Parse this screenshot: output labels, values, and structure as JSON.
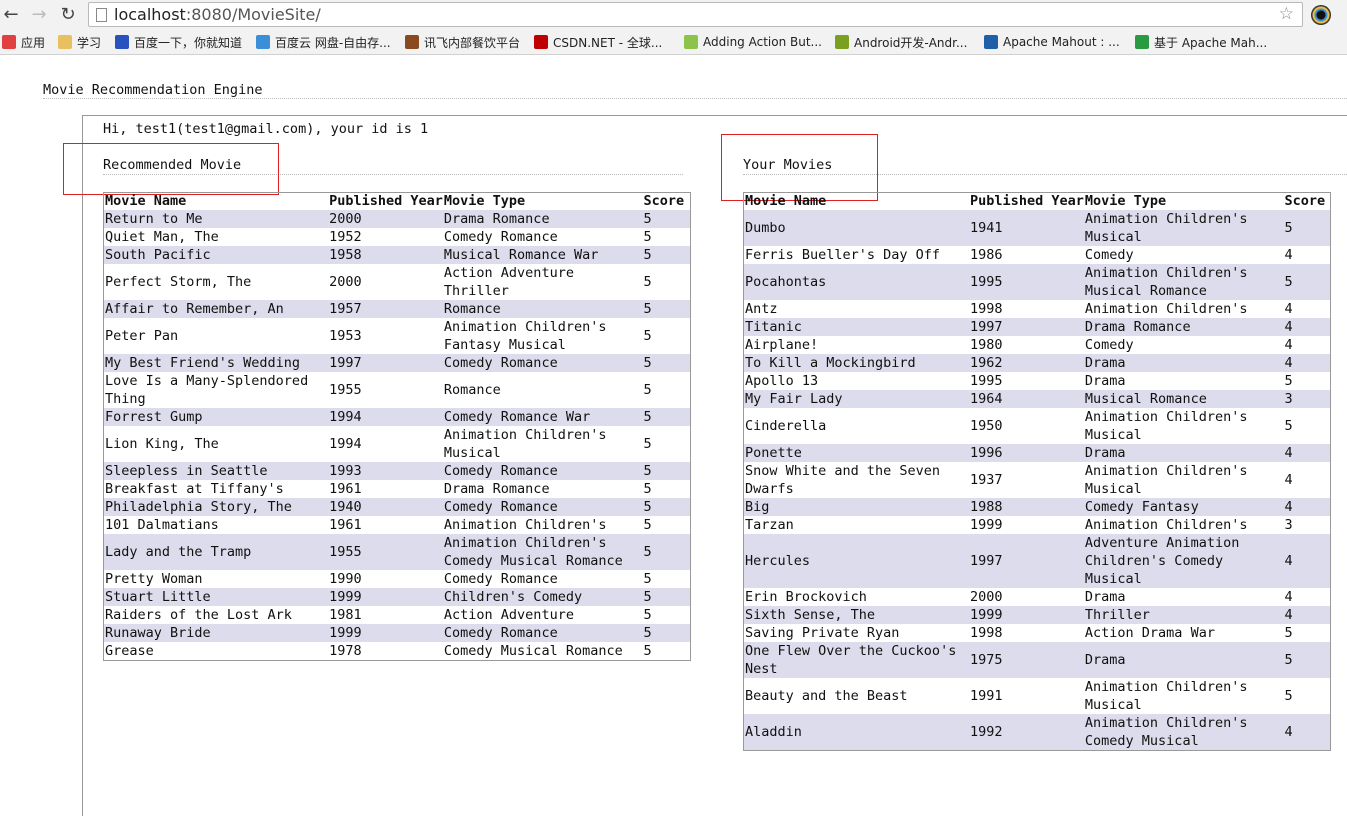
{
  "browser": {
    "url_host": "localhost",
    "url_rest": ":8080/MovieSite/",
    "bookmarks": [
      {
        "label": "应用",
        "icon": "apps-grid-icon",
        "color": "#e04040"
      },
      {
        "label": "学习",
        "icon": "folder-icon",
        "color": "#e8c060"
      },
      {
        "label": "百度一下，你就知道",
        "icon": "baidu-paw-icon",
        "color": "#2a52be"
      },
      {
        "label": "百度云 网盘-自由存...",
        "icon": "baidu-cloud-icon",
        "color": "#3a8fd8"
      },
      {
        "label": "讯飞内部餐饮平台",
        "icon": "bowl-icon",
        "color": "#8a4a20"
      },
      {
        "label": "CSDN.NET - 全球...",
        "icon": "csdn-icon",
        "color": "#c00000"
      },
      {
        "label": "Adding Action But...",
        "icon": "android-icon",
        "color": "#8cc34a"
      },
      {
        "label": "Android开发-Andr...",
        "icon": "android-dev-icon",
        "color": "#7aa020"
      },
      {
        "label": "Apache Mahout : ...",
        "icon": "ibm-icon",
        "color": "#1f5fa8"
      },
      {
        "label": "基于 Apache Mah...",
        "icon": "c-logo-icon",
        "color": "#2a9a40"
      }
    ]
  },
  "page": {
    "title": "Movie Recommendation Engine",
    "greeting": "Hi, test1(test1@gmail.com), your id is 1",
    "recommended": {
      "title": "Recommended Movie",
      "columns": [
        "Movie Name",
        "Published Year",
        "Movie Type",
        "Score"
      ],
      "rows": [
        [
          "Return to Me",
          "2000",
          "Drama Romance",
          "5"
        ],
        [
          "Quiet Man, The",
          "1952",
          "Comedy Romance",
          "5"
        ],
        [
          "South Pacific",
          "1958",
          "Musical Romance War",
          "5"
        ],
        [
          "Perfect Storm, The",
          "2000",
          "Action Adventure Thriller",
          "5"
        ],
        [
          "Affair to Remember, An",
          "1957",
          "Romance",
          "5"
        ],
        [
          "Peter Pan",
          "1953",
          "Animation Children's Fantasy Musical",
          "5"
        ],
        [
          "My Best Friend's Wedding",
          "1997",
          "Comedy Romance",
          "5"
        ],
        [
          "Love Is a Many-Splendored Thing",
          "1955",
          "Romance",
          "5"
        ],
        [
          "Forrest Gump",
          "1994",
          "Comedy Romance War",
          "5"
        ],
        [
          "Lion King, The",
          "1994",
          "Animation Children's Musical",
          "5"
        ],
        [
          "Sleepless in Seattle",
          "1993",
          "Comedy Romance",
          "5"
        ],
        [
          "Breakfast at Tiffany's",
          "1961",
          "Drama Romance",
          "5"
        ],
        [
          "Philadelphia Story, The",
          "1940",
          "Comedy Romance",
          "5"
        ],
        [
          "101 Dalmatians",
          "1961",
          "Animation Children's",
          "5"
        ],
        [
          "Lady and the Tramp",
          "1955",
          "Animation Children's Comedy Musical Romance",
          "5"
        ],
        [
          "Pretty Woman",
          "1990",
          "Comedy Romance",
          "5"
        ],
        [
          "Stuart Little",
          "1999",
          "Children's Comedy",
          "5"
        ],
        [
          "Raiders of the Lost Ark",
          "1981",
          "Action Adventure",
          "5"
        ],
        [
          "Runaway Bride",
          "1999",
          "Comedy Romance",
          "5"
        ],
        [
          "Grease",
          "1978",
          "Comedy Musical Romance",
          "5"
        ]
      ]
    },
    "yours": {
      "title": "Your Movies",
      "columns": [
        "Movie Name",
        "Published Year",
        "Movie Type",
        "Score"
      ],
      "rows": [
        [
          "Dumbo",
          "1941",
          "Animation Children's Musical",
          "5"
        ],
        [
          "Ferris Bueller's Day Off",
          "1986",
          "Comedy",
          "4"
        ],
        [
          "Pocahontas",
          "1995",
          "Animation Children's Musical Romance",
          "5"
        ],
        [
          "Antz",
          "1998",
          "Animation Children's",
          "4"
        ],
        [
          "Titanic",
          "1997",
          "Drama Romance",
          "4"
        ],
        [
          "Airplane!",
          "1980",
          "Comedy",
          "4"
        ],
        [
          "To Kill a Mockingbird",
          "1962",
          "Drama",
          "4"
        ],
        [
          "Apollo 13",
          "1995",
          "Drama",
          "5"
        ],
        [
          "My Fair Lady",
          "1964",
          "Musical Romance",
          "3"
        ],
        [
          "Cinderella",
          "1950",
          "Animation Children's Musical",
          "5"
        ],
        [
          "Ponette",
          "1996",
          "Drama",
          "4"
        ],
        [
          "Snow White and the Seven Dwarfs",
          "1937",
          "Animation Children's Musical",
          "4"
        ],
        [
          "Big",
          "1988",
          "Comedy Fantasy",
          "4"
        ],
        [
          "Tarzan",
          "1999",
          "Animation Children's",
          "3"
        ],
        [
          "Hercules",
          "1997",
          "Adventure Animation Children's Comedy Musical",
          "4"
        ],
        [
          "Erin Brockovich",
          "2000",
          "Drama",
          "4"
        ],
        [
          "Sixth Sense, The",
          "1999",
          "Thriller",
          "4"
        ],
        [
          "Saving Private Ryan",
          "1998",
          "Action Drama War",
          "5"
        ],
        [
          "One Flew Over the Cuckoo's Nest",
          "1975",
          "Drama",
          "5"
        ],
        [
          "Beauty and the Beast",
          "1991",
          "Animation Children's Musical",
          "5"
        ],
        [
          "Aladdin",
          "1992",
          "Animation Children's Comedy Musical",
          "4"
        ]
      ]
    }
  }
}
